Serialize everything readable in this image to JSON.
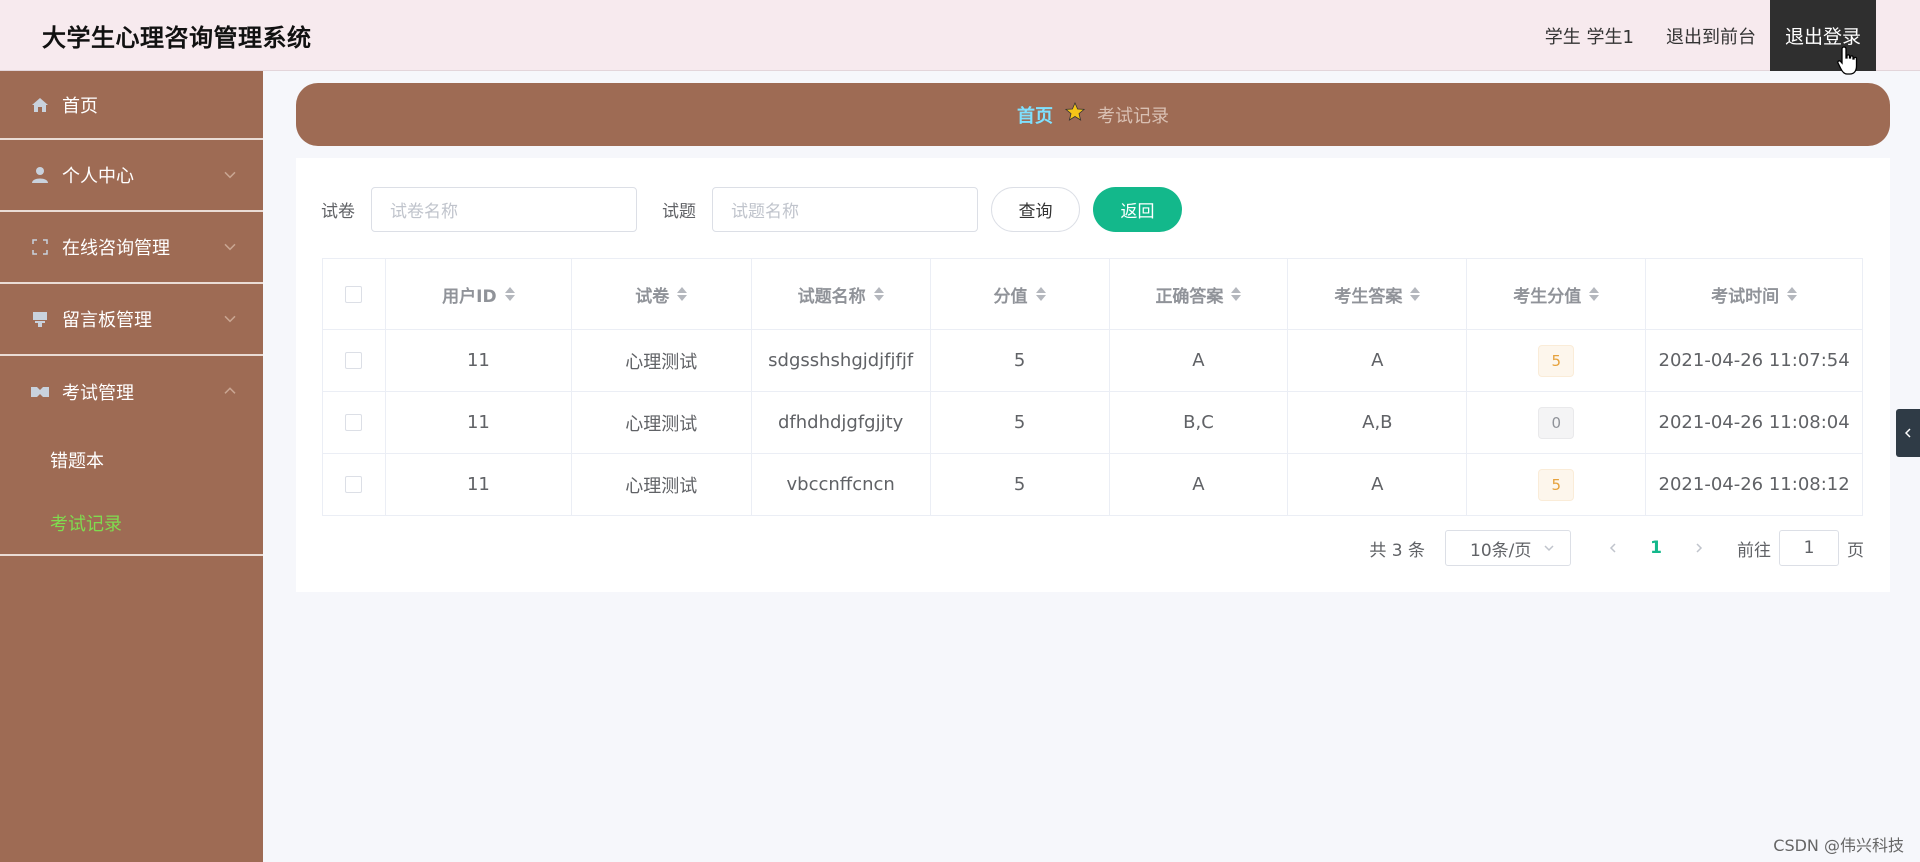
{
  "header": {
    "app_title": "大学生心理咨询管理系统",
    "user": "学生 学生1",
    "front_link": "退出到前台",
    "logout": "退出登录"
  },
  "sidebar": {
    "items": [
      {
        "label": "首页",
        "icon": "home-icon"
      },
      {
        "label": "个人中心",
        "icon": "user-icon"
      },
      {
        "label": "在线咨询管理",
        "icon": "consult-icon"
      },
      {
        "label": "留言板管理",
        "icon": "message-icon"
      },
      {
        "label": "考试管理",
        "icon": "exam-icon"
      }
    ],
    "sub_items": [
      {
        "label": "错题本"
      },
      {
        "label": "考试记录"
      }
    ]
  },
  "breadcrumb": {
    "home": "首页",
    "current": "考试记录"
  },
  "search": {
    "paper_label": "试卷",
    "paper_placeholder": "试卷名称",
    "question_label": "试题",
    "question_placeholder": "试题名称",
    "query_button": "查询",
    "back_button": "返回"
  },
  "table": {
    "columns": [
      "用户ID",
      "试卷",
      "试题名称",
      "分值",
      "正确答案",
      "考生答案",
      "考生分值",
      "考试时间"
    ],
    "rows": [
      {
        "user_id": "11",
        "paper": "心理测试",
        "question": "sdgsshshgjdjfjfjf",
        "score": "5",
        "correct": "A",
        "answer": "A",
        "got": "5",
        "time": "2021-04-26 11:07:54"
      },
      {
        "user_id": "11",
        "paper": "心理测试",
        "question": "dfhdhdjgfgjjty",
        "score": "5",
        "correct": "B,C",
        "answer": "A,B",
        "got": "0",
        "time": "2021-04-26 11:08:04"
      },
      {
        "user_id": "11",
        "paper": "心理测试",
        "question": "vbccnffcncn",
        "score": "5",
        "correct": "A",
        "answer": "A",
        "got": "5",
        "time": "2021-04-26 11:08:12"
      }
    ]
  },
  "pagination": {
    "total": "共 3 条",
    "page_size": "10条/页",
    "current_page": "1",
    "goto_label": "前往",
    "goto_value": "1",
    "page_suffix": "页"
  },
  "watermark": "CSDN @伟兴科技",
  "colors": {
    "sidebar": "#9e6b54",
    "accent_green": "#13b88b",
    "active_menu": "#7fdc4f",
    "topbar": "#f7eaee"
  }
}
